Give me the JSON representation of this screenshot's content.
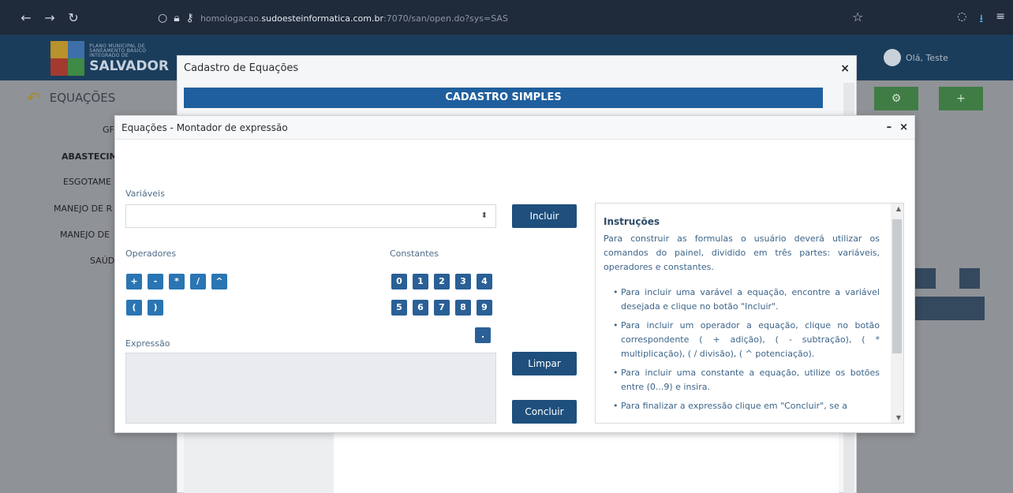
{
  "browser": {
    "back": "←",
    "forward": "→",
    "reload": "↻",
    "url_prefix": "homologacao.",
    "url_domain": "sudoesteinformatica.com.br",
    "url_suffix": ":7070/san/open.do?sys=SAS"
  },
  "app": {
    "logo_line1": "PLANO MUNICIPAL DE",
    "logo_line2": "SANEAMENTO BÁSICO",
    "logo_line3": "INTEGRADO DE",
    "logo_name": "SALVADOR",
    "user_greeting": "Olá, Teste",
    "page_title": "EQUAÇÕES",
    "side_items": [
      "GF",
      "ABASTECIM",
      "ESGOTAME",
      "MANEJO DE R",
      "MANEJO DE",
      "SAÚD"
    ],
    "settings_btn": "⚙",
    "add_btn": "+"
  },
  "cadastro": {
    "title": "Cadastro de Equações",
    "close": "×",
    "banner": "CADASTRO SIMPLES"
  },
  "montador": {
    "title": "Equações - Montador de expressão",
    "minimize": "–",
    "close": "×",
    "variaveis_label": "Variáveis",
    "operadores_label": "Operadores",
    "constantes_label": "Constantes",
    "expressao_label": "Expressão",
    "operators": [
      "+",
      "-",
      "*",
      "/",
      "^"
    ],
    "parens": [
      "(",
      ")"
    ],
    "constants_row1": [
      "0",
      "1",
      "2",
      "3",
      "4"
    ],
    "constants_row2": [
      "5",
      "6",
      "7",
      "8",
      "9"
    ],
    "decimal": ".",
    "incluir_btn": "Incluir",
    "limpar_btn": "Limpar",
    "concluir_btn": "Concluir",
    "instructions": {
      "title": "Instruções",
      "intro": "Para construir as formulas o usuário deverá utilizar os comandos do painel, dividido em três partes: variáveis, operadores e constantes.",
      "b1": "Para incluir uma varável a equação, encontre a variável desejada e clique no botão \"Incluir\".",
      "b2": "Para incluir um operador a equação, clique no botão correspondente ( + adição), ( - subtração), ( * multiplicação), ( / divisão), ( ^ potenciação).",
      "b3": "Para incluir uma constante a equação, utilize os botões entre (0...9) e insira.",
      "b4": "Para finalizar a expressão clique em \"Concluir\", se a"
    }
  }
}
